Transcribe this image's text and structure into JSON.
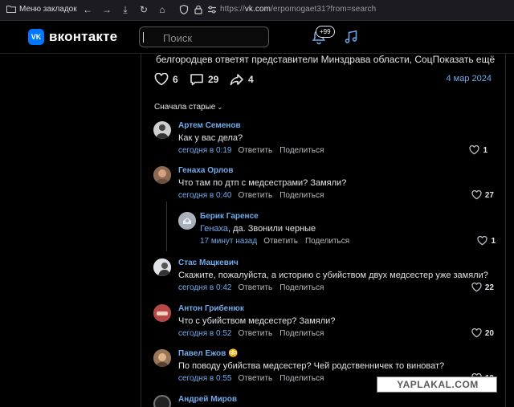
{
  "browser": {
    "bookmarks_label": "Меню закладок",
    "url_prefix": "https://",
    "url_host": "vk.com",
    "url_path": "/erpomogaet31?from=search"
  },
  "header": {
    "brand": "вконтакте",
    "logo_text": "VK",
    "search_placeholder": "Поиск",
    "notifications_badge": "+99"
  },
  "post": {
    "text_tail": "белгородцев ответят представители Минздрава области, Соц",
    "show_more": "Показать ещё",
    "likes": "6",
    "comments": "29",
    "shares": "4",
    "date": "4 мар 2024"
  },
  "comments_sort": "Сначала старые",
  "comments": [
    {
      "author": "Артем Семенов",
      "text": "Как у вас дела?",
      "time": "сегодня в 0:19",
      "reply": "Ответить",
      "share": "Поделиться",
      "likes": "1"
    },
    {
      "author": "Генаха Орлов",
      "text": "Что там по дтп с медсестрами? Замяли?",
      "time": "сегодня в 0:40",
      "reply": "Ответить",
      "share": "Поделиться",
      "likes": "27"
    },
    {
      "author": "Берик Гаренсе",
      "mention": "Генаха",
      "text": ", да. Звонили черные",
      "time": "17 минут назад",
      "reply": "Ответить",
      "share": "Поделиться",
      "likes": "1"
    },
    {
      "author": "Стас Мацкевич",
      "text": "Скажите, пожалуйста, а историю с убийством двух медсестер уже замяли?",
      "time": "сегодня в 0:42",
      "reply": "Ответить",
      "share": "Поделиться",
      "likes": "22"
    },
    {
      "author": "Антон Грибенюк",
      "text": "Что с убийством медсестер? Замяли?",
      "time": "сегодня в 0:52",
      "reply": "Ответить",
      "share": "Поделиться",
      "likes": "20"
    },
    {
      "author": "Павел Ежов",
      "author_emoji": "😳",
      "text": "По поводу убийства медсестер? Чей родственничек то виноват?",
      "time": "сегодня в 0:55",
      "reply": "Ответить",
      "share": "Поделиться",
      "likes": "19"
    },
    {
      "author": "Андрей Миров"
    }
  ],
  "watermark": "YAPLAKAL.COM",
  "colors": {
    "accent": "#71aaeb",
    "brand": "#0077ff",
    "background": "#000000"
  }
}
